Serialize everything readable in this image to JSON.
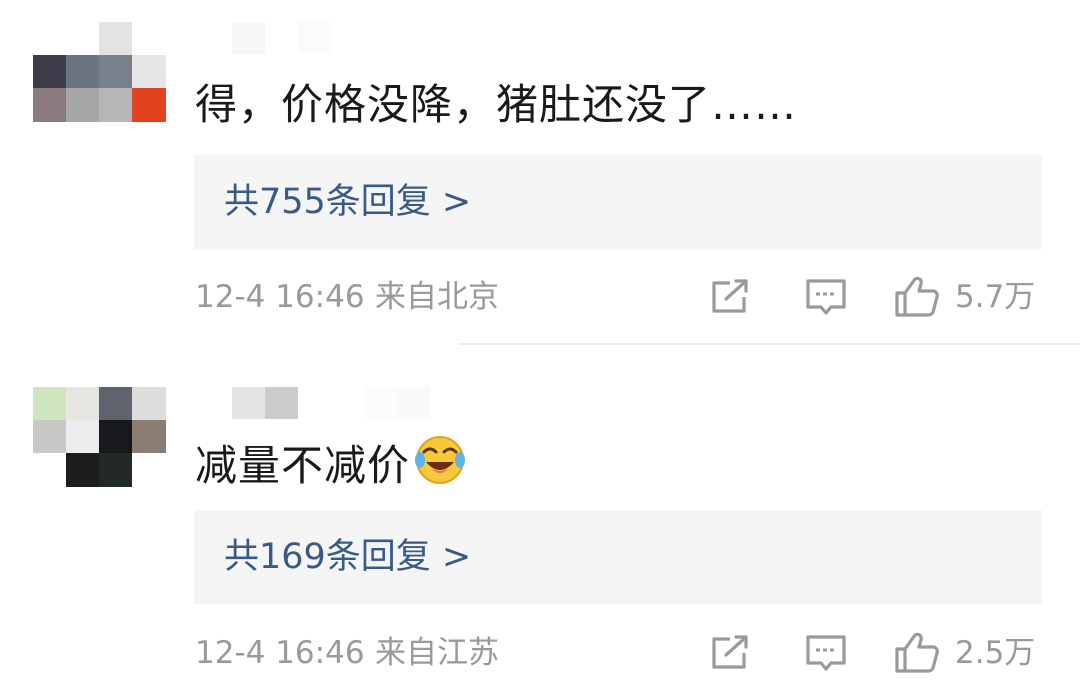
{
  "comments": [
    {
      "text": "得，价格没降，猪肚还没了……",
      "replies_label": "共755条回复 >",
      "time": "12-4 16:46",
      "location": "来自北京",
      "likes": "5.7万",
      "avatar_colors": [
        "#3d3a4a",
        "#6b7280",
        "#7a7f8c",
        "#e6e6e6",
        "#8b7b80",
        "#a7a7a9",
        "#b6b6b8",
        "#e2431e"
      ]
    },
    {
      "text": "减量不减价",
      "emoji": "laugh-cry",
      "replies_label": "共169条回复 >",
      "time": "12-4 16:46",
      "location": "来自江苏",
      "likes": "2.5万",
      "avatar_colors": [
        "#cfe5c0",
        "#e7e7e2",
        "#5f636e",
        "#dddddd",
        "#c8c8c6",
        "#ececec",
        "#17191c",
        "#8c7d72",
        "#f2f2f2",
        "#1b1d1e",
        "#232a25",
        "#ffffff"
      ]
    }
  ],
  "colors": {
    "link": "#3a5a86",
    "meta": "#9a9a9a",
    "text": "#1a1a1a",
    "reply_bg": "#f5f5f5"
  }
}
